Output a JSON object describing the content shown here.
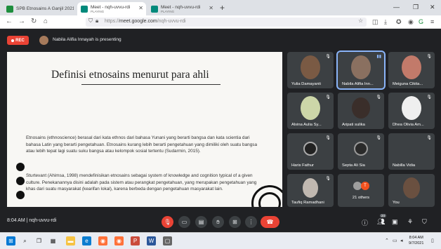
{
  "browser": {
    "tabs": [
      {
        "title": "SPB Etnosains A Ganjil 2021/202",
        "subtitle": "",
        "favicon_color": "#1e8e3e",
        "active": false
      },
      {
        "title": "Meet - nqh-uvvu-rdi",
        "subtitle": "PLAYING",
        "favicon_color": "#00897b",
        "active": true
      },
      {
        "title": "Meet - nqh-uvvu-rdi",
        "subtitle": "PLAYING",
        "favicon_color": "#00897b",
        "active": false
      }
    ],
    "url_scheme": "https://",
    "url_host": "meet.google.com",
    "url_path": "/nqh-uvvu-rdi"
  },
  "meet": {
    "rec_label": "REC",
    "presenter_text": "Nabila Alifia Innayah is presenting",
    "meeting_code": "nqh-uvvu-rdi",
    "time": "8:04 AM",
    "participant_badge": "24",
    "others_label": "21 others"
  },
  "slide": {
    "title": "Definisi etnosains menurut para ahli",
    "paragraph1": "Etnosains (ethnoscience) berasal dari kata ethnos dari bahasa Yunani yang berarti bangsa dan kata scientia dari bahasa Latin yang berarti pengetahuan. Etnosains kurang lebih berarti pengetahuan yang dimiliki oleh suatu bangsa atau lebih tepat lagi suatu suku bangsa atau kelompok sosial tertentu (Sudarmin, 2015).",
    "paragraph2": "Sturtevant (Ahimsa, 1998) mendefinisikan etnosains sebagai system of knowledge and cognition typical of a given culture. Penekanannya disini adalah pada sistem atau perangkat pengetahuan, yang merupakan pengetahuan yang khas dari suatu masyarakat (kearifan lokal), karena berbeda dengan pengetahuan masyarakat lain."
  },
  "participants": [
    {
      "name": "Yulia Damayanti",
      "face_color": "#7a5a44"
    },
    {
      "name": "Nabila Alifia Inn...",
      "face_color": "#8a7060",
      "speaking": true
    },
    {
      "name": "Meiguna Cikita...",
      "face_color": "#c27a6a"
    },
    {
      "name": "Alvina Aulia Sy...",
      "face_color": "#ccd6a8"
    },
    {
      "name": "Aripati sulika",
      "face_color": "#3a2e2a"
    },
    {
      "name": "Dhea Olivia Am...",
      "face_color": "#efefef"
    },
    {
      "name": "Haris Fathur",
      "face_color": "#222222"
    },
    {
      "name": "Septa Ali Sia",
      "face_color": "#2a2a2a"
    },
    {
      "name": "Nabilla Vidia",
      "face_color": "#3c4043"
    },
    {
      "name": "Taufiq Ramadhani",
      "face_color": "#c0b8b0"
    },
    {
      "name": "21 others",
      "face_color": "#3c4043"
    },
    {
      "name": "You",
      "face_color": "#6a5040"
    }
  ],
  "taskbar": {
    "time": "8:04 AM",
    "date": "9/7/2021"
  },
  "colors": {
    "meet_bg": "#202124",
    "tile_bg": "#3c4043",
    "red": "#ea4335",
    "speaking_border": "#8ab4f8"
  }
}
